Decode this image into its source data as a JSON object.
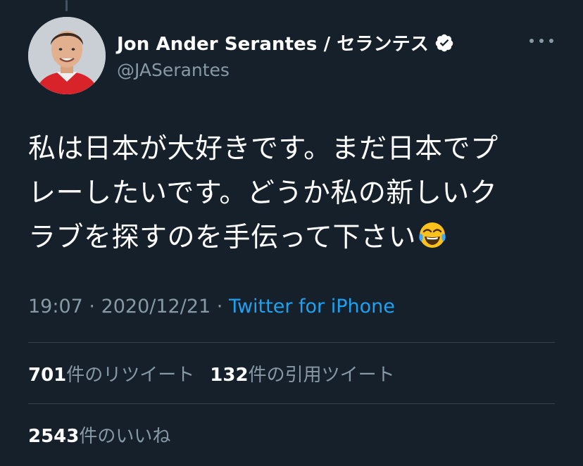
{
  "user": {
    "display_name": "Jon Ander Serantes / セランテス",
    "handle": "@JASerantes",
    "verified": true
  },
  "tweet": {
    "lines": [
      "私は日本が大好きです。まだ日本でプ",
      "レーしたいです。どうか私の新しいク",
      "ラブを探すのを手伝って下さい"
    ],
    "emoji": "face-with-tears-of-joy"
  },
  "meta": {
    "time": "19:07",
    "separator": " · ",
    "date": "2020/12/21",
    "source": "Twitter for iPhone"
  },
  "stats": {
    "retweets_count": "701",
    "retweets_label": "件のリツイート",
    "quotes_count": "132",
    "quotes_label": "件の引用ツイート",
    "likes_count": "2543",
    "likes_label": "件のいいね"
  },
  "colors": {
    "background": "#15202b",
    "text": "#ffffff",
    "secondary": "#8899a6",
    "link": "#1da1f2",
    "divider": "#38444d"
  }
}
